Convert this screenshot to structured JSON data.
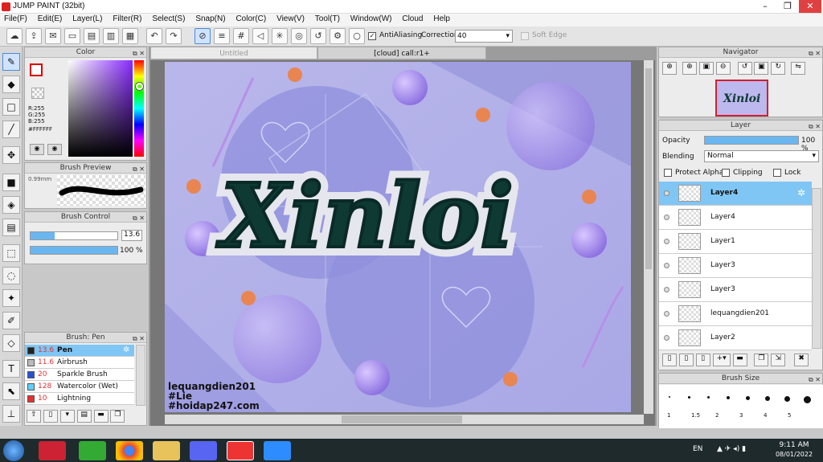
{
  "window": {
    "title": "JUMP PAINT (32bit)"
  },
  "menu": [
    "File(F)",
    "Edit(E)",
    "Layer(L)",
    "Filter(R)",
    "Select(S)",
    "Snap(N)",
    "Color(C)",
    "View(V)",
    "Tool(T)",
    "Window(W)",
    "Cloud",
    "Help"
  ],
  "toolbar": {
    "antialiasing": "AntiAliasing",
    "correction_label": "Correction",
    "correction_value": "40",
    "soft_edge": "Soft Edge"
  },
  "color_panel": {
    "title": "Color",
    "r": "R:255",
    "g": "G:255",
    "b": "B:255",
    "hex": "#FFFFFF"
  },
  "brush_preview": {
    "title": "Brush Preview",
    "size": "0.99mm"
  },
  "brush_control": {
    "title": "Brush Control",
    "size_value": "13.6",
    "size_fraction": 0.28,
    "opacity_value": "100 %",
    "opacity_fraction": 1.0
  },
  "brush_list": {
    "title": "Brush: Pen",
    "items": [
      {
        "size": "13.6",
        "name": "Pen",
        "color": "#222222"
      },
      {
        "size": "11.6",
        "name": "Airbrush",
        "color": "#bbbbbb"
      },
      {
        "size": "20",
        "name": "Sparkle Brush",
        "color": "#2a50d6"
      },
      {
        "size": "128",
        "name": "Watercolor (Wet)",
        "color": "#5ed0ff"
      },
      {
        "size": "10",
        "name": "Lightning",
        "color": "#e83030"
      }
    ]
  },
  "tabs": {
    "untitled": "Untitled",
    "cloud": "[cloud] call:r1+"
  },
  "canvas": {
    "art_text": "Xinloi",
    "credit1": "lequangdien201",
    "credit2": "#Lie",
    "credit3": "#hoidap247.com"
  },
  "navigator": {
    "title": "Navigator"
  },
  "layer_panel": {
    "title": "Layer",
    "opacity_label": "Opacity",
    "opacity_value": "100 %",
    "opacity_fraction": 1.0,
    "blending_label": "Blending",
    "blending_value": "Normal",
    "protect_alpha": "Protect Alpha",
    "clipping": "Clipping",
    "lock": "Lock",
    "layers": [
      "Layer4",
      "Layer4",
      "Layer1",
      "Layer3",
      "Layer3",
      "lequangdien201",
      "Layer2"
    ]
  },
  "brush_size": {
    "title": "Brush Size",
    "sizes": [
      "1",
      "1.5",
      "2",
      "3",
      "4",
      "5"
    ]
  },
  "taskbar": {
    "lang": "EN",
    "time": "9:11 AM",
    "date": "08/01/2022"
  }
}
